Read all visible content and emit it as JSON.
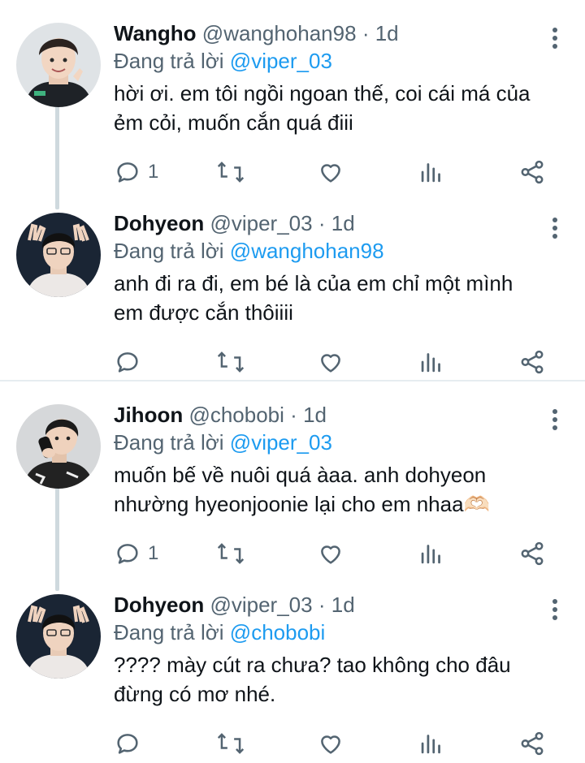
{
  "threads": [
    {
      "tweets": [
        {
          "display_name": "Wangho",
          "handle": "@wanghohan98",
          "time": "1d",
          "reply_prefix": "Đang trả lời",
          "reply_to": "@viper_03",
          "text_line1": "hời ơi. em tôi ngồi ngoan thế, coi cái má của",
          "text_line2": "ẻm cỏi, muốn cắn quá điii",
          "reply_count": "1",
          "retweet_count": "",
          "like_count": ""
        },
        {
          "display_name": "Dohyeon",
          "handle": "@viper_03",
          "time": "1d",
          "reply_prefix": "Đang trả lời",
          "reply_to": "@wanghohan98",
          "text_line1": "anh đi ra đi, em bé là của em chỉ một mình",
          "text_line2": "em được cắn thôiiii",
          "reply_count": "",
          "retweet_count": "",
          "like_count": ""
        }
      ]
    },
    {
      "tweets": [
        {
          "display_name": "Jihoon",
          "handle": "@chobobi",
          "time": "1d",
          "reply_prefix": "Đang trả lời",
          "reply_to": "@viper_03",
          "text_line1": "muốn bế về nuôi quá àaa. anh dohyeon",
          "text_line2": "nhường hyeonjoonie lại cho em nhaa🫶🏻",
          "reply_count": "1",
          "retweet_count": "",
          "like_count": ""
        },
        {
          "display_name": "Dohyeon",
          "handle": "@viper_03",
          "time": "1d",
          "reply_prefix": "Đang trả lời",
          "reply_to": "@chobobi",
          "text_line1": "???? mày cút ra chưa? tao không cho đâu",
          "text_line2": "đừng có mơ nhé.",
          "reply_count": "",
          "retweet_count": "",
          "like_count": ""
        }
      ]
    }
  ],
  "separator": "·",
  "colors": {
    "accent": "#1d9bf0",
    "muted": "#536471",
    "text": "#0f1419",
    "divider": "#e6ecf0"
  },
  "icons": [
    "reply-icon",
    "retweet-icon",
    "like-icon",
    "views-icon",
    "share-icon",
    "more-icon"
  ]
}
